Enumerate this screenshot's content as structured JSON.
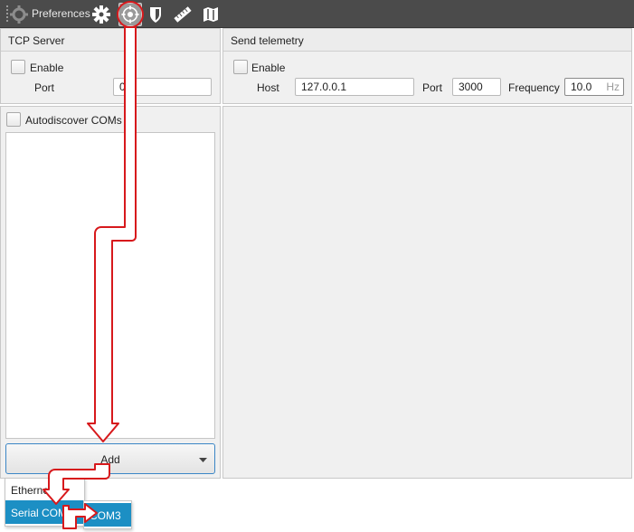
{
  "toolbar": {
    "title": "Preferences",
    "icons": [
      "grip-gear-icon",
      "gear-icon",
      "network-target-icon",
      "shield-icon",
      "ruler-icon",
      "map-icon"
    ]
  },
  "tcp_server": {
    "title": "TCP Server",
    "enable_label": "Enable",
    "port_label": "Port",
    "port_value": "0"
  },
  "telemetry": {
    "title": "Send telemetry",
    "enable_label": "Enable",
    "host_label": "Host",
    "host_value": "127.0.0.1",
    "port_label": "Port",
    "port_value": "3000",
    "frequency_label": "Frequency",
    "frequency_value": "10.0",
    "frequency_unit": "Hz"
  },
  "coms": {
    "autodiscover_label": "Autodiscover COMs",
    "add_label": "Add"
  },
  "add_menu": {
    "items": [
      "Ethernet",
      "Serial COM"
    ],
    "submenu_items": [
      "COM3"
    ]
  },
  "colors": {
    "toolbar_bg": "#4b4b4b",
    "highlight": "#1c8fc4",
    "annotation": "#d7191c"
  }
}
